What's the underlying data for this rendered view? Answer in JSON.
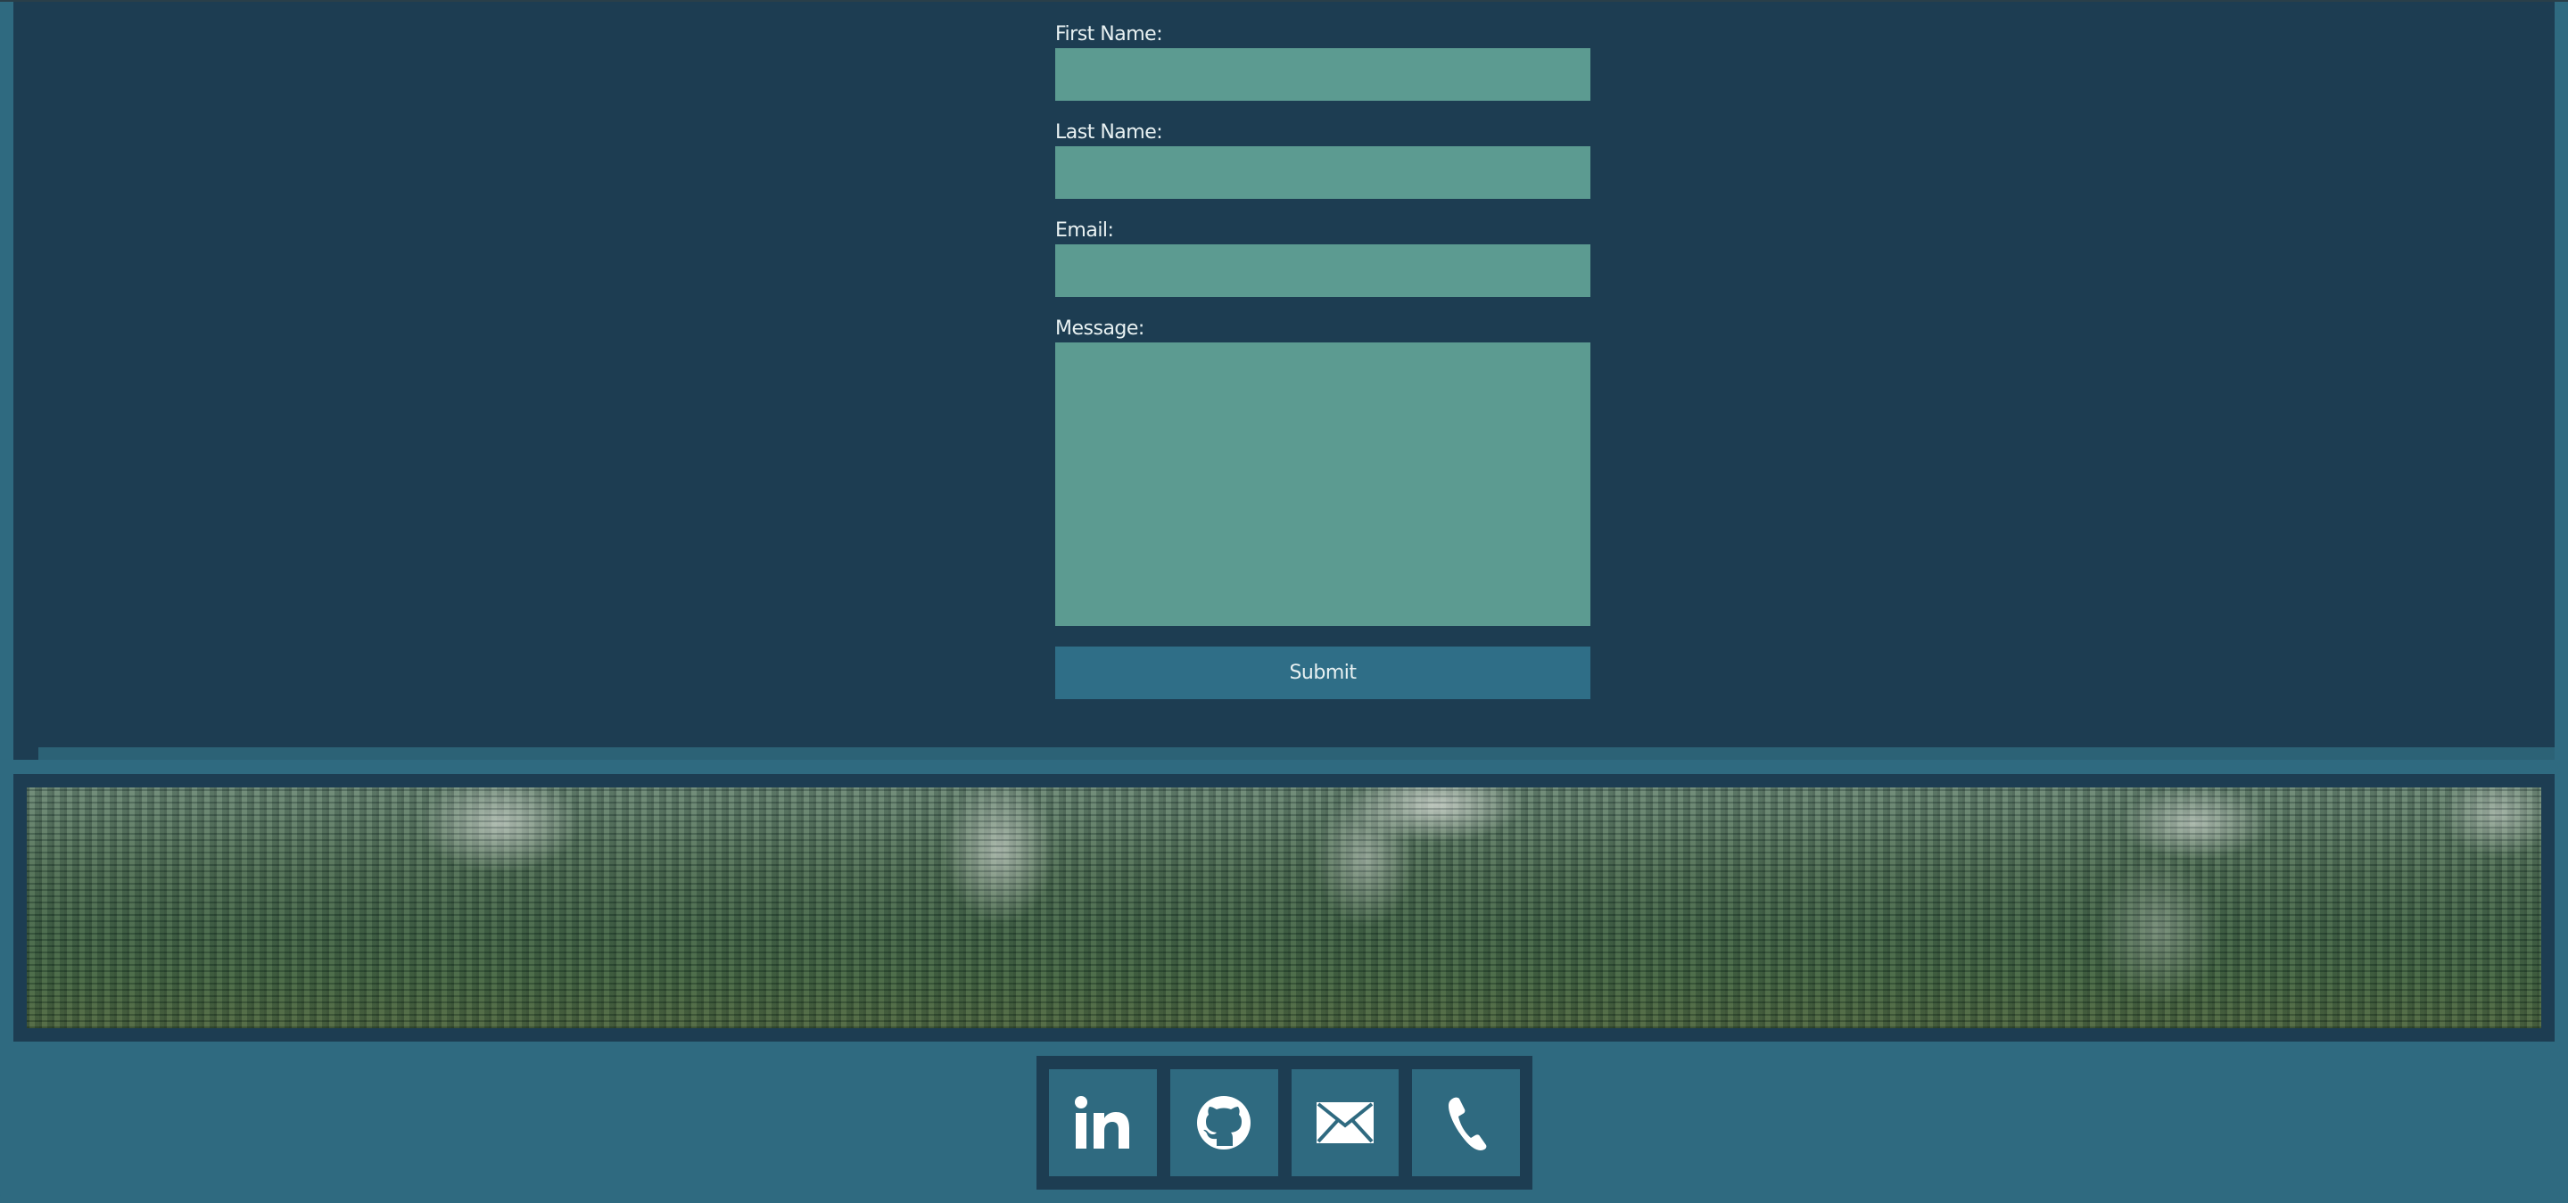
{
  "form": {
    "first_name_label": "First Name:",
    "last_name_label": "Last Name:",
    "email_label": "Email:",
    "message_label": "Message:",
    "first_name_value": "",
    "last_name_value": "",
    "email_value": "",
    "message_value": "",
    "submit_label": "Submit"
  },
  "banner": {
    "image": "forest-mist"
  },
  "social": {
    "items": [
      {
        "icon": "linkedin-icon"
      },
      {
        "icon": "github-icon"
      },
      {
        "icon": "mail-icon"
      },
      {
        "icon": "phone-icon"
      }
    ]
  },
  "colors": {
    "page_bg": "#2f6a80",
    "panel_bg": "#1d3d52",
    "input_bg": "#5c9b91",
    "button_bg": "#2f6e87",
    "text": "#e8f1f2"
  }
}
